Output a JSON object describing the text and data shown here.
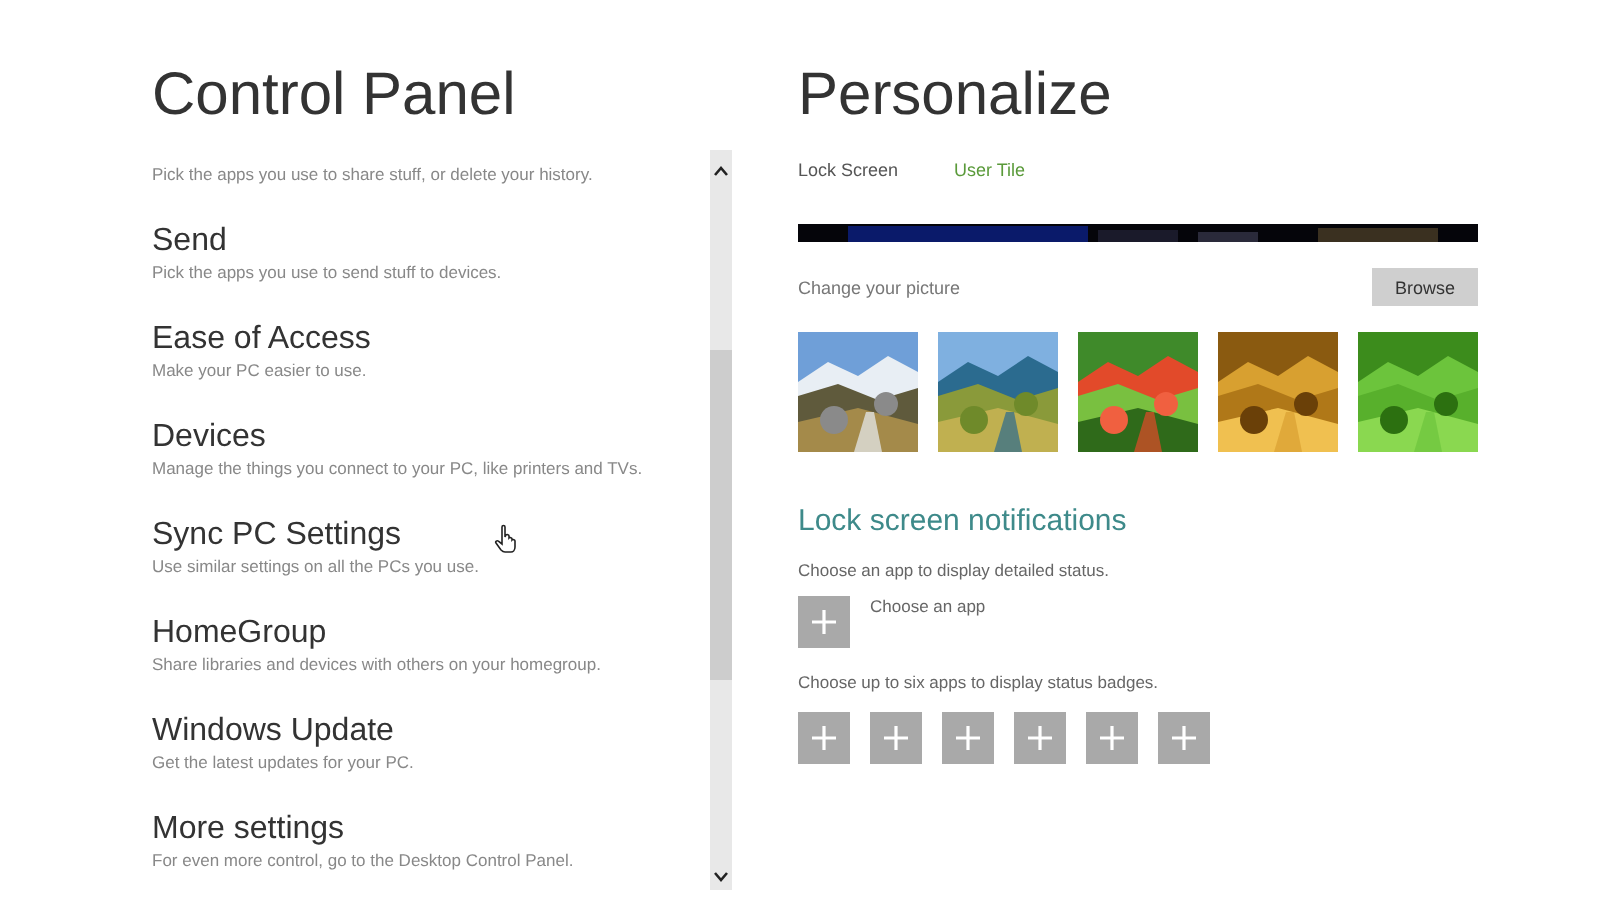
{
  "left": {
    "title": "Control Panel",
    "items": [
      {
        "description": "Pick the apps you use to share stuff, or delete your history."
      },
      {
        "title": "Send",
        "description": "Pick the apps you use to send stuff to devices."
      },
      {
        "title": "Ease of Access",
        "description": "Make your PC easier to use."
      },
      {
        "title": "Devices",
        "description": "Manage the things you connect to your PC, like printers and TVs."
      },
      {
        "title": "Sync PC Settings",
        "description": "Use similar settings on all the PCs you use."
      },
      {
        "title": "HomeGroup",
        "description": "Share libraries and devices with others on your homegroup."
      },
      {
        "title": "Windows Update",
        "description": "Get the latest updates for your PC."
      },
      {
        "title": "More settings",
        "description": "For even more control, go to the Desktop Control Panel."
      }
    ]
  },
  "right": {
    "title": "Personalize",
    "tabs": [
      {
        "label": "Lock Screen",
        "selected": true
      },
      {
        "label": "User Tile",
        "selected": false
      }
    ],
    "change_label": "Change your picture",
    "browse_button": "Browse",
    "notifications": {
      "title": "Lock screen notifications",
      "detailed_prompt": "Choose an app to display detailed status.",
      "detailed_label": "Choose an app",
      "badges_prompt": "Choose up to six apps to display status badges.",
      "badge_slots": [
        {
          "kind": "add"
        },
        {
          "kind": "add"
        },
        {
          "kind": "add"
        },
        {
          "kind": "add"
        },
        {
          "kind": "add"
        },
        {
          "kind": "add"
        }
      ]
    }
  }
}
